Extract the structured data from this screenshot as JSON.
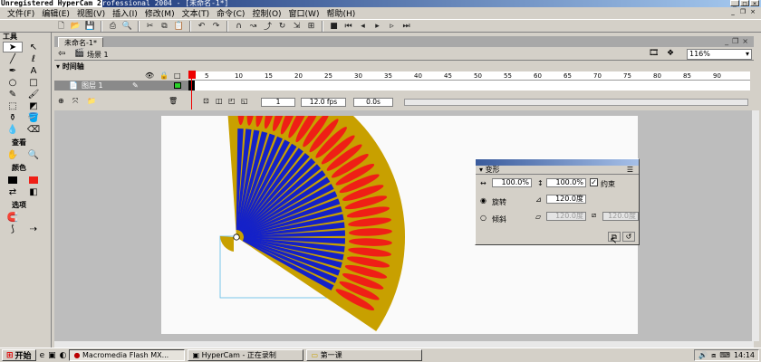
{
  "titlebar": {
    "watermark": "Unregistered HyperCam 2",
    "title_rest": "rofessional 2004 - [未命名-1*]"
  },
  "menu": [
    "文件(F)",
    "编辑(E)",
    "视图(V)",
    "插入(I)",
    "修改(M)",
    "文本(T)",
    "命令(C)",
    "控制(O)",
    "窗口(W)",
    "帮助(H)"
  ],
  "tools_panel": {
    "title": "工具",
    "view_label": "查看",
    "colors_label": "颜色",
    "options_label": "选项"
  },
  "document": {
    "tab_label": "未命名-1*",
    "scene_label": "场景 1",
    "zoom_value": "116%"
  },
  "timeline": {
    "title": "时间轴",
    "layer_name": "图层 1",
    "ruler_ticks": [
      "5",
      "10",
      "15",
      "20",
      "25",
      "30",
      "35",
      "40",
      "45",
      "50",
      "55",
      "60",
      "65",
      "70",
      "75",
      "80",
      "85",
      "90"
    ],
    "current_frame": "1",
    "fps": "12.0 fps",
    "elapsed": "0.0s"
  },
  "transform_panel": {
    "title": "变形",
    "width_pct": "100.0%",
    "height_pct": "100.0%",
    "constrain_label": "约束",
    "constrain_checked": true,
    "rotate_label": "旋转",
    "rotate_value": "120.0度",
    "skew_label": "倾斜",
    "skew_h_value": "120.0度",
    "skew_v_value": "120.0度",
    "selected_option": "rotate"
  },
  "fan_colors": {
    "rim": "#c8a000",
    "red": "#ef1f16",
    "blue": "#1421c8"
  },
  "taskbar": {
    "start_label": "开始",
    "tasks": [
      {
        "label": "Macromedia Flash MX...",
        "active": true
      },
      {
        "label": "HyperCam - 正在录制",
        "active": false
      },
      {
        "label": "第一课",
        "active": false
      }
    ],
    "clock": "14:14"
  }
}
